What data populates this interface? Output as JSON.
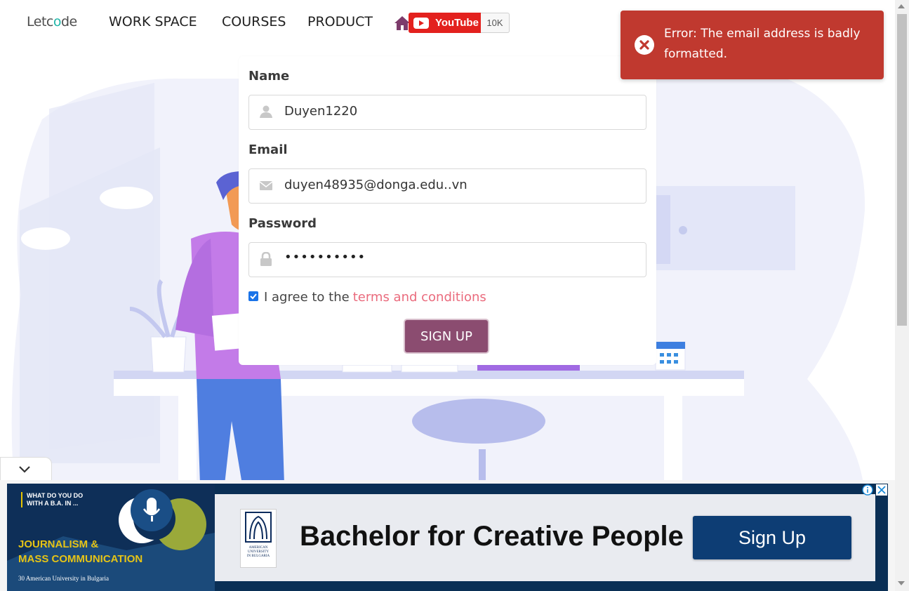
{
  "nav": {
    "logo_left": "Letc",
    "logo_accent": "o",
    "logo_right": "de",
    "items": [
      "WORK SPACE",
      "COURSES",
      "PRODUCT"
    ],
    "youtube_label": "YouTube",
    "youtube_count": "10K"
  },
  "form": {
    "name_label": "Name",
    "name_value": "Duyen1220",
    "email_label": "Email",
    "email_value": "duyen48935@donga.edu..vn",
    "password_label": "Password",
    "password_value": "••••••••••",
    "agree_text": "I agree to the",
    "terms_link": "terms and conditions",
    "agree_checked": true,
    "signup_label": "SIGN UP"
  },
  "toast": {
    "message": "Error: The email address is badly formatted."
  },
  "ad": {
    "question": [
      "WHAT DO YOU DO",
      "WITH A B.A. IN ..."
    ],
    "program": [
      "JOURNALISM &",
      "MASS COMMUNICATION"
    ],
    "university": "30 American University in Bulgaria",
    "logo_text": [
      "AMERICAN",
      "UNIVERSITY",
      "IN BULGARIA"
    ],
    "headline": "Bachelor for Creative People",
    "cta": "Sign Up"
  },
  "colors": {
    "brand": "#8b4c70",
    "toast_error": "#c0392f",
    "youtube": "#e3211e",
    "link": "#ea6b7d",
    "ad_cta": "#0d3d74"
  }
}
